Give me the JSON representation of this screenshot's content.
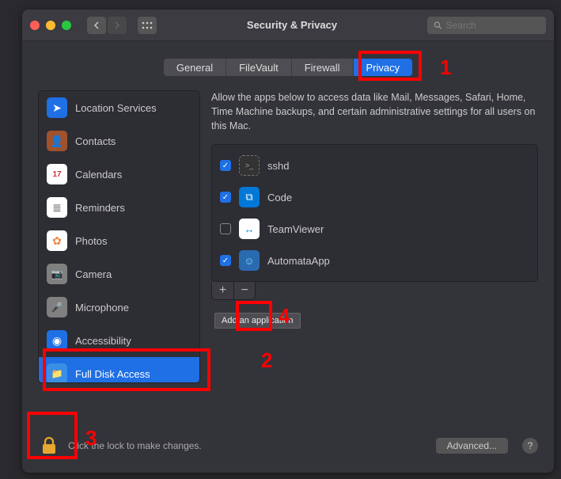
{
  "window": {
    "title": "Security & Privacy",
    "search_placeholder": "Search"
  },
  "tabs": [
    {
      "label": "General"
    },
    {
      "label": "FileVault"
    },
    {
      "label": "Firewall"
    },
    {
      "label": "Privacy"
    }
  ],
  "sidebar": {
    "items": [
      {
        "label": "Location Services",
        "icon_bg": "#1f6fe5",
        "glyph": "➤"
      },
      {
        "label": "Contacts",
        "icon_bg": "#a0522d",
        "glyph": "👤"
      },
      {
        "label": "Calendars",
        "icon_bg": "#ffffff",
        "glyph": "17"
      },
      {
        "label": "Reminders",
        "icon_bg": "#ffffff",
        "glyph": "≣"
      },
      {
        "label": "Photos",
        "icon_bg": "#ffffff",
        "glyph": "✿"
      },
      {
        "label": "Camera",
        "icon_bg": "#808080",
        "glyph": "📷"
      },
      {
        "label": "Microphone",
        "icon_bg": "#808080",
        "glyph": "🎤"
      },
      {
        "label": "Accessibility",
        "icon_bg": "#1f6fe5",
        "glyph": "◉"
      },
      {
        "label": "Full Disk Access",
        "icon_bg": "#1f6fe5",
        "glyph": "📁"
      }
    ]
  },
  "detail": {
    "description": "Allow the apps below to access data like Mail, Messages, Safari, Home, Time Machine backups, and certain administrative settings for all users on this Mac.",
    "apps": [
      {
        "name": "sshd",
        "checked": true,
        "icon_bg": "#333",
        "glyph": ">_"
      },
      {
        "name": "Code",
        "checked": true,
        "icon_bg": "#0078d7",
        "glyph": "⧉"
      },
      {
        "name": "TeamViewer",
        "checked": false,
        "icon_bg": "#0d8ae6",
        "glyph": "↔"
      },
      {
        "name": "AutomataApp",
        "checked": true,
        "icon_bg": "#2a6bb0",
        "glyph": "☺"
      }
    ],
    "tooltip": "Add an application"
  },
  "footer": {
    "lock_text": "Click the lock to make changes.",
    "advanced": "Advanced...",
    "help": "?"
  },
  "annotations": {
    "n1": "1",
    "n2": "2",
    "n3": "3",
    "n4": "4"
  }
}
